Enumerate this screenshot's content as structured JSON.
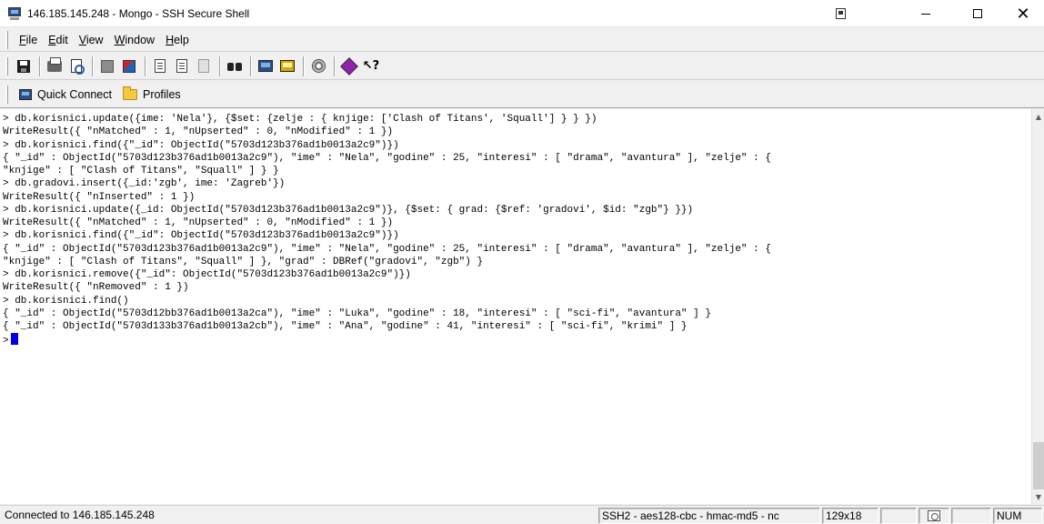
{
  "window": {
    "title": "146.185.145.248 - Mongo - SSH Secure Shell",
    "controls": {
      "minimize": "—",
      "maximize": "☐",
      "close": "✕"
    }
  },
  "menu": {
    "items": [
      {
        "label": "File",
        "accel": "F",
        "rest": "ile"
      },
      {
        "label": "Edit",
        "accel": "E",
        "rest": "dit"
      },
      {
        "label": "View",
        "accel": "V",
        "rest": "iew"
      },
      {
        "label": "Window",
        "accel": "W",
        "rest": "indow"
      },
      {
        "label": "Help",
        "accel": "H",
        "rest": "elp"
      }
    ]
  },
  "toolbar": {
    "icons": [
      "save-icon",
      "print-icon",
      "print-preview-icon",
      "grayscale-icon",
      "color-icon",
      "copy-icon",
      "paste-icon",
      "paste-disabled-icon",
      "find-icon",
      "new-terminal-icon",
      "new-file-transfer-icon",
      "settings-icon",
      "help-icon",
      "whats-this-icon"
    ]
  },
  "profiles_bar": {
    "quick_connect": "Quick Connect",
    "profiles": "Profiles"
  },
  "terminal": {
    "lines": [
      "> db.korisnici.update({ime: 'Nela'}, {$set: {zelje : { knjige: ['Clash of Titans', 'Squall'] } } })",
      "WriteResult({ \"nMatched\" : 1, \"nUpserted\" : 0, \"nModified\" : 1 })",
      "> db.korisnici.find({\"_id\": ObjectId(\"5703d123b376ad1b0013a2c9\")})",
      "{ \"_id\" : ObjectId(\"5703d123b376ad1b0013a2c9\"), \"ime\" : \"Nela\", \"godine\" : 25, \"interesi\" : [ \"drama\", \"avantura\" ], \"zelje\" : {",
      "\"knjige\" : [ \"Clash of Titans\", \"Squall\" ] } }",
      "> db.gradovi.insert({_id:'zgb', ime: 'Zagreb'})",
      "WriteResult({ \"nInserted\" : 1 })",
      "> db.korisnici.update({_id: ObjectId(\"5703d123b376ad1b0013a2c9\")}, {$set: { grad: {$ref: 'gradovi', $id: \"zgb\"} }})",
      "WriteResult({ \"nMatched\" : 1, \"nUpserted\" : 0, \"nModified\" : 1 })",
      "> db.korisnici.find({\"_id\": ObjectId(\"5703d123b376ad1b0013a2c9\")})",
      "{ \"_id\" : ObjectId(\"5703d123b376ad1b0013a2c9\"), \"ime\" : \"Nela\", \"godine\" : 25, \"interesi\" : [ \"drama\", \"avantura\" ], \"zelje\" : {",
      "\"knjige\" : [ \"Clash of Titans\", \"Squall\" ] }, \"grad\" : DBRef(\"gradovi\", \"zgb\") }",
      "> db.korisnici.remove({\"_id\": ObjectId(\"5703d123b376ad1b0013a2c9\")})",
      "WriteResult({ \"nRemoved\" : 1 })",
      "> db.korisnici.find()",
      "{ \"_id\" : ObjectId(\"5703d12bb376ad1b0013a2ca\"), \"ime\" : \"Luka\", \"godine\" : 18, \"interesi\" : [ \"sci-fi\", \"avantura\" ] }",
      "{ \"_id\" : ObjectId(\"5703d133b376ad1b0013a2cb\"), \"ime\" : \"Ana\", \"godine\" : 41, \"interesi\" : [ \"sci-fi\", \"krimi\" ] }"
    ],
    "prompt": ">"
  },
  "status": {
    "connection": "Connected to 146.185.145.248",
    "cipher": "SSH2 - aes128-cbc - hmac-md5 - nc",
    "size": "129x18",
    "num": "NUM"
  }
}
